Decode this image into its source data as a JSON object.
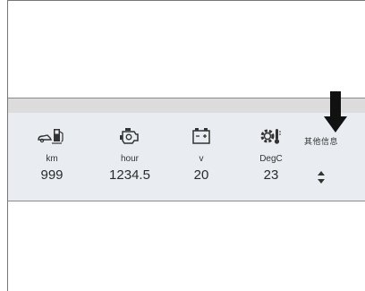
{
  "gauges": [
    {
      "id": "km",
      "icon": "fuel-range-icon",
      "unit": "km",
      "value": "999"
    },
    {
      "id": "hour",
      "icon": "engine-icon",
      "unit": "hour",
      "value": "1234.5"
    },
    {
      "id": "volt",
      "icon": "battery-icon",
      "unit": "v",
      "value": "20"
    },
    {
      "id": "temp",
      "icon": "gear-temperature-icon",
      "unit": "DegC",
      "value": "23"
    }
  ],
  "other_info": {
    "label": "其他信息",
    "control_icon": "up-down-arrows-icon"
  },
  "pointer_icon": "down-arrow-icon",
  "colors": {
    "panel": "#e9edf1",
    "band": "#dcdcdc",
    "border": "#777777",
    "text": "#2a2a2a"
  }
}
